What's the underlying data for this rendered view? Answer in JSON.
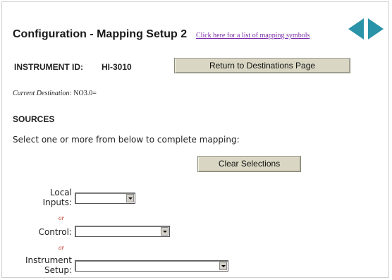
{
  "header": {
    "title": "Configuration - Mapping Setup 2",
    "symbols_link": "Click here for a list of mapping symbols",
    "nav": {
      "prev_icon": "left-arrow",
      "next_icon": "right-arrow",
      "color": "#2a93a8"
    }
  },
  "instrument": {
    "label": "INSTRUMENT ID:",
    "value": "HI-3010",
    "return_button": "Return to Destinations Page"
  },
  "current_destination": {
    "label": "Current Destination:",
    "value": "NO3.0="
  },
  "sources": {
    "heading": "SOURCES",
    "instruction": "Select one or more from below to complete mapping:",
    "clear_button": "Clear Selections",
    "or_text": "or",
    "fields": [
      {
        "label_line1": "Local",
        "label_line2": "Inputs:",
        "value": ""
      },
      {
        "label_line1": "Control:",
        "value": ""
      },
      {
        "label_line1": "Instrument",
        "label_line2": "Setup:",
        "value": ""
      }
    ]
  }
}
